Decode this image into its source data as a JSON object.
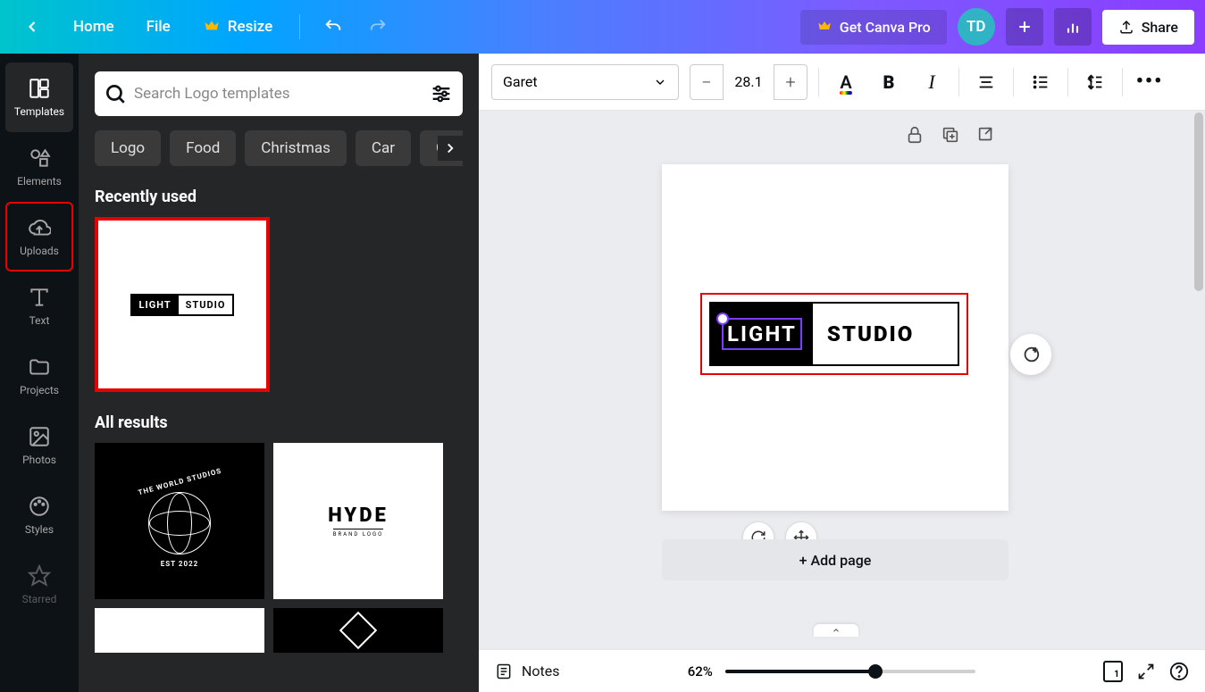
{
  "topbar": {
    "home": "Home",
    "file": "File",
    "resize": "Resize",
    "pro": "Get Canva Pro",
    "avatar": "TD",
    "share": "Share"
  },
  "rail": {
    "templates": "Templates",
    "elements": "Elements",
    "uploads": "Uploads",
    "text": "Text",
    "projects": "Projects",
    "photos": "Photos",
    "styles": "Styles",
    "starred": "Starred"
  },
  "panel": {
    "search_placeholder": "Search Logo templates",
    "chips": [
      "Logo",
      "Food",
      "Christmas",
      "Car",
      "Gaming"
    ],
    "recent_title": "Recently used",
    "all_results_title": "All results",
    "recent_logo_left": "LIGHT",
    "recent_logo_right": "STUDIO",
    "world_top": "THE WORLD STUDIOS",
    "world_est": "EST 2022",
    "hyde_title": "HYDE",
    "hyde_sub": "BRAND LOGO"
  },
  "toolbar": {
    "font": "Garet",
    "size": "28.1",
    "minus": "−",
    "plus": "+",
    "bold": "B",
    "italic": "I",
    "textA": "A"
  },
  "canvas": {
    "big_logo_left": "LIGHT",
    "big_logo_right": "STUDIO",
    "add_page": "+ Add page"
  },
  "footer": {
    "notes": "Notes",
    "zoom": "62%",
    "page_num": "1"
  }
}
